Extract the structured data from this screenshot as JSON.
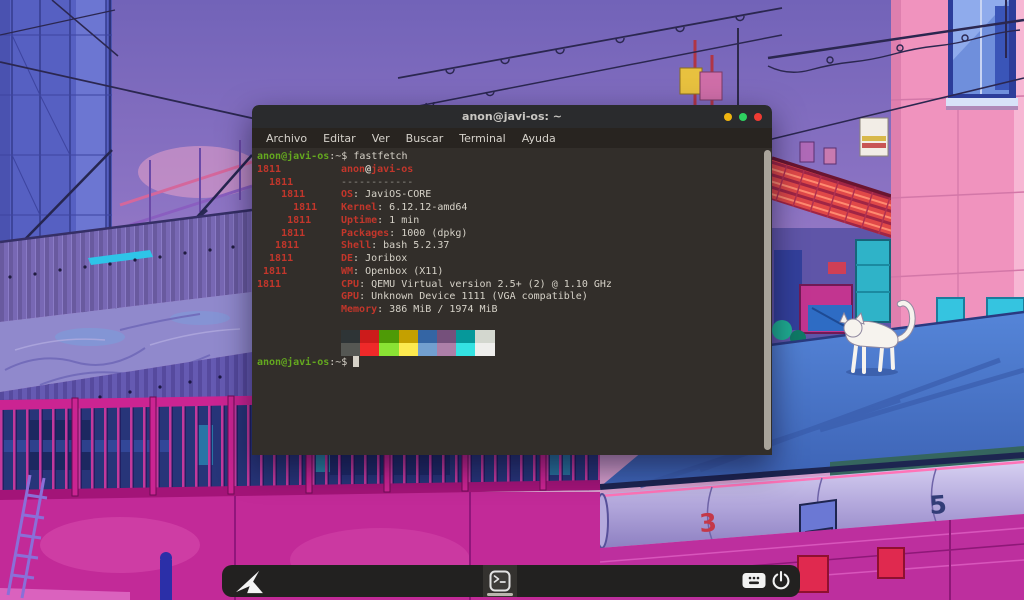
{
  "window": {
    "title": "anon@javi-os: ~",
    "menu": [
      "Archivo",
      "Editar",
      "Ver",
      "Buscar",
      "Terminal",
      "Ayuda"
    ],
    "buttons": [
      {
        "name": "minimize",
        "color": "#efb410"
      },
      {
        "name": "maximize",
        "color": "#2ed160"
      },
      {
        "name": "close",
        "color": "#ef3b33"
      }
    ]
  },
  "terminal": {
    "prompt_user": "anon@javi-os",
    "prompt_suffix": ":~$ ",
    "command": "fastfetch",
    "colors": {
      "background": "#322e2a",
      "foreground": "#d6d2c8",
      "prompt_green": "#64a81f",
      "accent_red": "#c2362b"
    },
    "fetch": {
      "label_sep": ": ",
      "title": {
        "logo": "1811",
        "user": "anon",
        "at": "@",
        "host": "javi-os"
      },
      "separator": {
        "logo": "  1811",
        "text": "------------"
      },
      "rows": [
        {
          "logo": "    1811",
          "label": "OS",
          "value": "JaviOS-CORE"
        },
        {
          "logo": "      1811",
          "label": "Kernel",
          "value": "6.12.12-amd64"
        },
        {
          "logo": "     1811",
          "label": "Uptime",
          "value": "1 min"
        },
        {
          "logo": "    1811",
          "label": "Packages",
          "value": "1000 (dpkg)"
        },
        {
          "logo": "   1811",
          "label": "Shell",
          "value": "bash 5.2.37"
        },
        {
          "logo": "  1811",
          "label": "DE",
          "value": "Joribox"
        },
        {
          "logo": " 1811",
          "label": "WM",
          "value": "Openbox (X11)"
        },
        {
          "logo": "1811",
          "label": "CPU",
          "value": "QEMU Virtual version 2.5+ (2) @ 1.10 GHz"
        },
        {
          "logo": "",
          "label": "GPU",
          "value": "Unknown Device 1111 (VGA compatible)"
        },
        {
          "logo": "",
          "label": "Memory",
          "value": "386 MiB / 1974 MiB"
        }
      ],
      "palette_row1": [
        "#2e3436",
        "#cc1b1b",
        "#4e9a06",
        "#c4a000",
        "#3465a4",
        "#75507b",
        "#06989a",
        "#d3d7cf"
      ],
      "palette_row2": [
        "#555753",
        "#ef2929",
        "#8ae234",
        "#fce94f",
        "#729fcf",
        "#ad7fa8",
        "#34e2e2",
        "#eeeeec"
      ]
    }
  },
  "taskbar": {
    "launcher_icon": "paper-plane-logo",
    "active_app": "terminal",
    "icons": [
      "terminal-app",
      "keyboard",
      "power"
    ]
  },
  "wallpaper": {
    "description": "anime city at dusk, purple-pink sky, power lines, white cat on blue roof",
    "gutter_numbers": [
      "3",
      "5"
    ]
  }
}
